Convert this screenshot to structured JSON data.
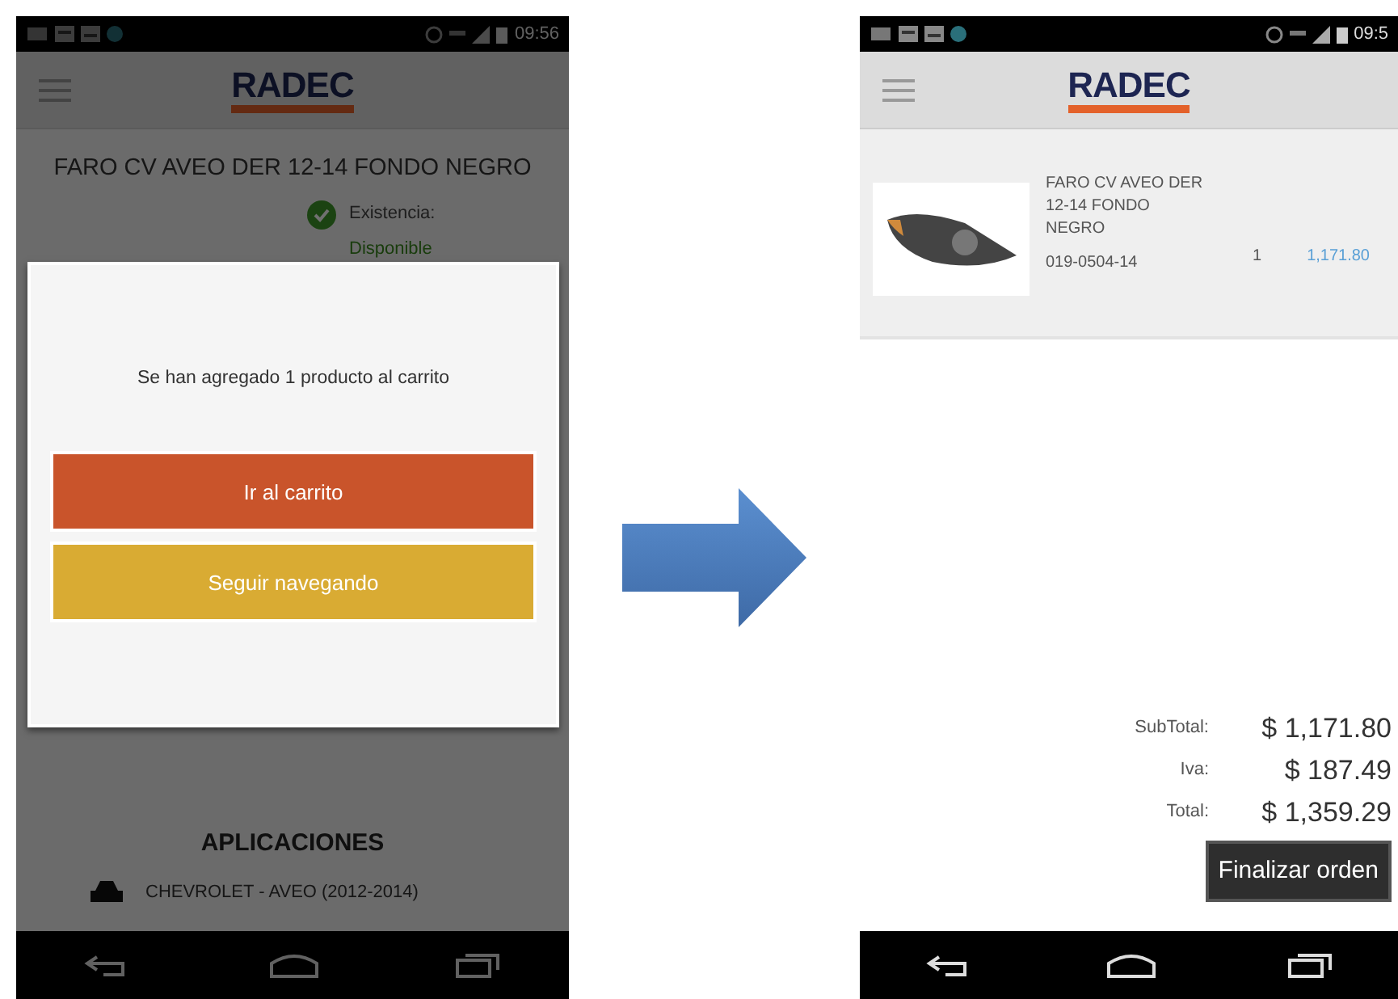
{
  "product_screen": {
    "status_time": "09:56",
    "logo": "RADEC",
    "dimmed": true,
    "product_title": "FARO CV AVEO DER 12-14 FONDO NEGRO",
    "stock_label": "Existencia:",
    "stock_value": "Disponible",
    "section_heading": "APLICACIONES",
    "applications": [
      {
        "text": "CHEVROLET - AVEO (2012-2014)"
      }
    ],
    "dialog": {
      "message": "Se han agregado 1 producto al carrito",
      "buttons": [
        {
          "label": "Ir al carrito",
          "color": "#c9542b"
        },
        {
          "label": "Seguir navegando",
          "color": "#d9ab33"
        }
      ]
    }
  },
  "cart_screen": {
    "status_time": "09:5",
    "logo": "RADEC",
    "items": [
      {
        "description": "FARO CV AVEO DER 12-14 FONDO NEGRO",
        "code": "019-0504-14",
        "quantity": "1",
        "price": "1,171.80"
      }
    ],
    "totals": [
      {
        "label": "SubTotal:",
        "value": "$ 1,171.80"
      },
      {
        "label": "Iva:",
        "value": "$ 187.49"
      },
      {
        "label": "Total:",
        "value": "$ 1,359.29"
      }
    ],
    "checkout_button": "Finalizar orden"
  }
}
